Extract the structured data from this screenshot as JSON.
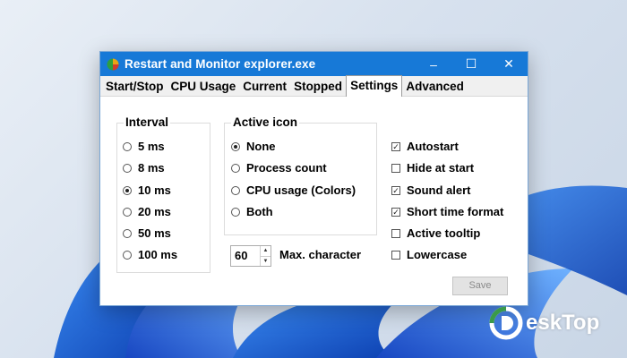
{
  "window": {
    "title": "Restart and Monitor explorer.exe",
    "controls": [
      "–",
      "☐",
      "✕"
    ]
  },
  "tabs": [
    "Start/Stop",
    "CPU Usage",
    "Current",
    "Stopped",
    "Settings",
    "Advanced"
  ],
  "active_tab": "Settings",
  "interval": {
    "title": "Interval",
    "options": [
      "5 ms",
      "8 ms",
      "10 ms",
      "20 ms",
      "50 ms",
      "100 ms"
    ],
    "selected": "10 ms"
  },
  "active_icon": {
    "title": "Active icon",
    "options": [
      "None",
      "Process count",
      "CPU usage (Colors)",
      "Both"
    ],
    "selected": "None"
  },
  "max_character": {
    "value": "60",
    "label": "Max. character"
  },
  "options": [
    {
      "label": "Autostart",
      "checked": true
    },
    {
      "label": "Hide at start",
      "checked": false
    },
    {
      "label": "Sound alert",
      "checked": true
    },
    {
      "label": "Short time format",
      "checked": true
    },
    {
      "label": "Active tooltip",
      "checked": false
    },
    {
      "label": "Lowercase",
      "checked": false
    }
  ],
  "save_label": "Save",
  "watermark": {
    "text": "eskTop"
  },
  "colors": {
    "titlebar": "#1779d7",
    "wallpaper_bloom": "#1e5fd8"
  }
}
